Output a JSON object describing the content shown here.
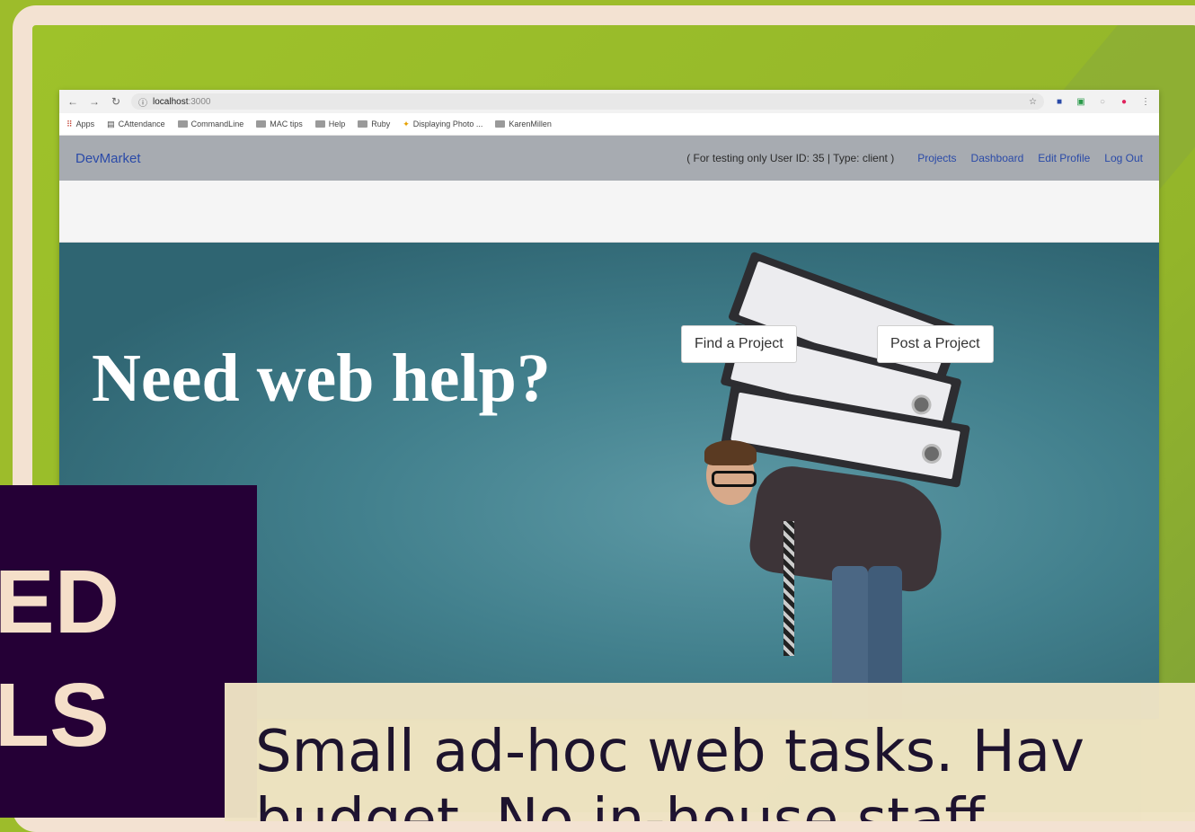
{
  "browser": {
    "url_host": "localhost",
    "url_port": ":3000",
    "bookmarks": [
      "Apps",
      "CAttendance",
      "CommandLine",
      "MAC tips",
      "Help",
      "Ruby",
      "Displaying Photo ...",
      "KarenMillen"
    ]
  },
  "navbar": {
    "brand": "DevMarket",
    "test_note": "( For testing only User ID: 35 | Type: client )",
    "links": [
      "Projects",
      "Dashboard",
      "Edit Profile",
      "Log Out"
    ]
  },
  "hero": {
    "title": "Need web help?",
    "find_button": "Find a Project",
    "post_button": "Post a Project"
  },
  "overlay": {
    "line1": "ED",
    "line2": "LS"
  },
  "caption": {
    "line1": "Small ad-hoc web tasks. Hav",
    "line2": "budget. No in-house staff."
  },
  "colors": {
    "background_green": "#9dbc2b",
    "frame_cream": "#f3e2d2",
    "overlay_purple": "#250036",
    "caption_cream": "#efe4c4",
    "nav_link_blue": "#2a4aa8"
  }
}
